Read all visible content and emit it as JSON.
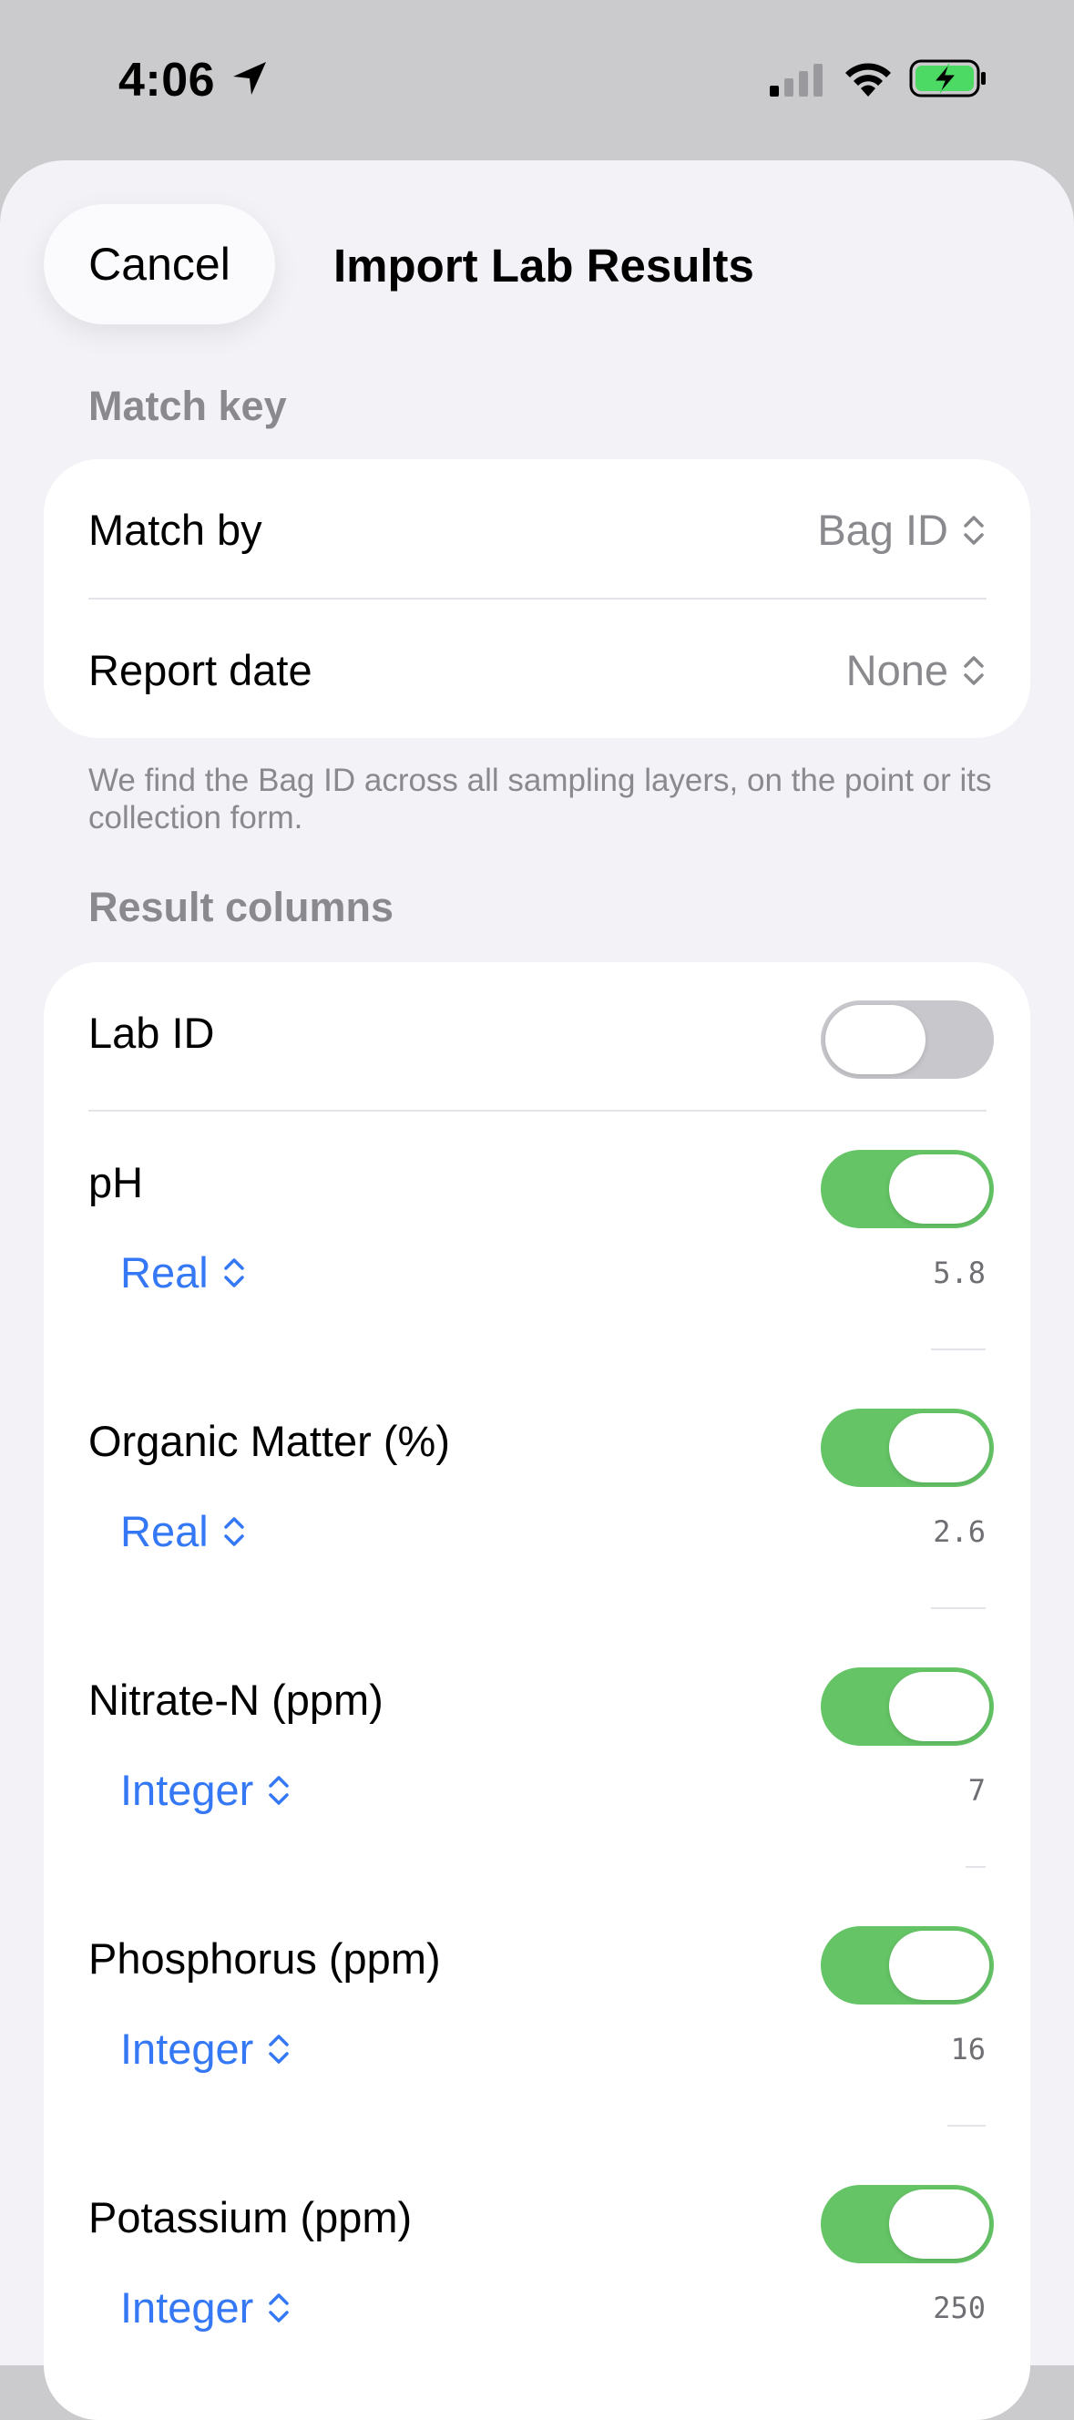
{
  "status_bar": {
    "time": "4:06",
    "icons": [
      "location-arrow-icon",
      "cellular-signal-icon",
      "wifi-icon",
      "battery-charging-icon"
    ]
  },
  "header": {
    "cancel_label": "Cancel",
    "title": "Import Lab Results"
  },
  "match_key": {
    "section_title": "Match key",
    "rows": [
      {
        "label": "Match by",
        "value": "Bag ID"
      },
      {
        "label": "Report date",
        "value": "None"
      }
    ],
    "footnote": "We find the Bag ID across all sampling layers, on the point or its collection form."
  },
  "result_columns": {
    "section_title": "Result columns",
    "lab_id": {
      "label": "Lab ID",
      "enabled": false
    },
    "columns": [
      {
        "label": "pH",
        "enabled": true,
        "type": "Real",
        "sample": "5.8"
      },
      {
        "label": "Organic Matter (%)",
        "enabled": true,
        "type": "Real",
        "sample": "2.6"
      },
      {
        "label": "Nitrate-N (ppm)",
        "enabled": true,
        "type": "Integer",
        "sample": "7"
      },
      {
        "label": "Phosphorus (ppm)",
        "enabled": true,
        "type": "Integer",
        "sample": "16"
      },
      {
        "label": "Potassium (ppm)",
        "enabled": true,
        "type": "Integer",
        "sample": "250"
      }
    ]
  },
  "colors": {
    "accent": "#3478f6",
    "toggle_on": "#65c466",
    "toggle_off": "#c7c7cc",
    "background": "#f2f2f7"
  }
}
